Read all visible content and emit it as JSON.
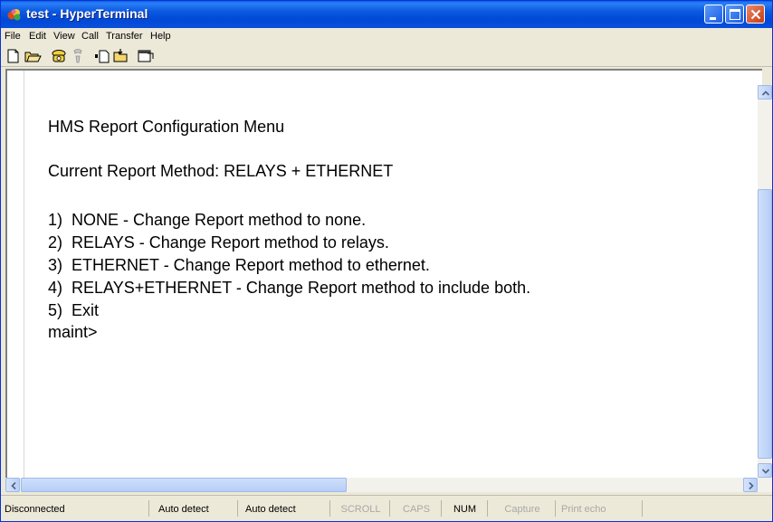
{
  "window": {
    "title": "test - HyperTerminal",
    "colors": {
      "titlebar": "#0b58e0",
      "close_button": "#c63b12",
      "terminal_bg": "#ffffff"
    }
  },
  "menu": {
    "items": [
      "File",
      "Edit",
      "View",
      "Call",
      "Transfer",
      "Help"
    ]
  },
  "toolbar": {
    "icons": [
      "new-connection-icon",
      "open-icon",
      "call-icon",
      "disconnect-icon",
      "send-icon",
      "receive-icon",
      "properties-icon"
    ]
  },
  "terminal": {
    "lines": [
      "HMS Report Configuration Menu",
      "Current Report Method: RELAYS + ETHERNET",
      "1)  NONE - Change Report method to none.",
      "2)  RELAYS - Change Report method to relays.",
      "3)  ETHERNET - Change Report method to ethernet.",
      "4)  RELAYS+ETHERNET - Change Report method to include both.",
      "5)  Exit",
      "maint>"
    ]
  },
  "statusbar": {
    "connection": "Disconnected",
    "auto_detect_1": "Auto detect",
    "auto_detect_2": "Auto detect",
    "scroll": "SCROLL",
    "caps": "CAPS",
    "num": "NUM",
    "capture": "Capture",
    "print_echo": "Print echo"
  }
}
